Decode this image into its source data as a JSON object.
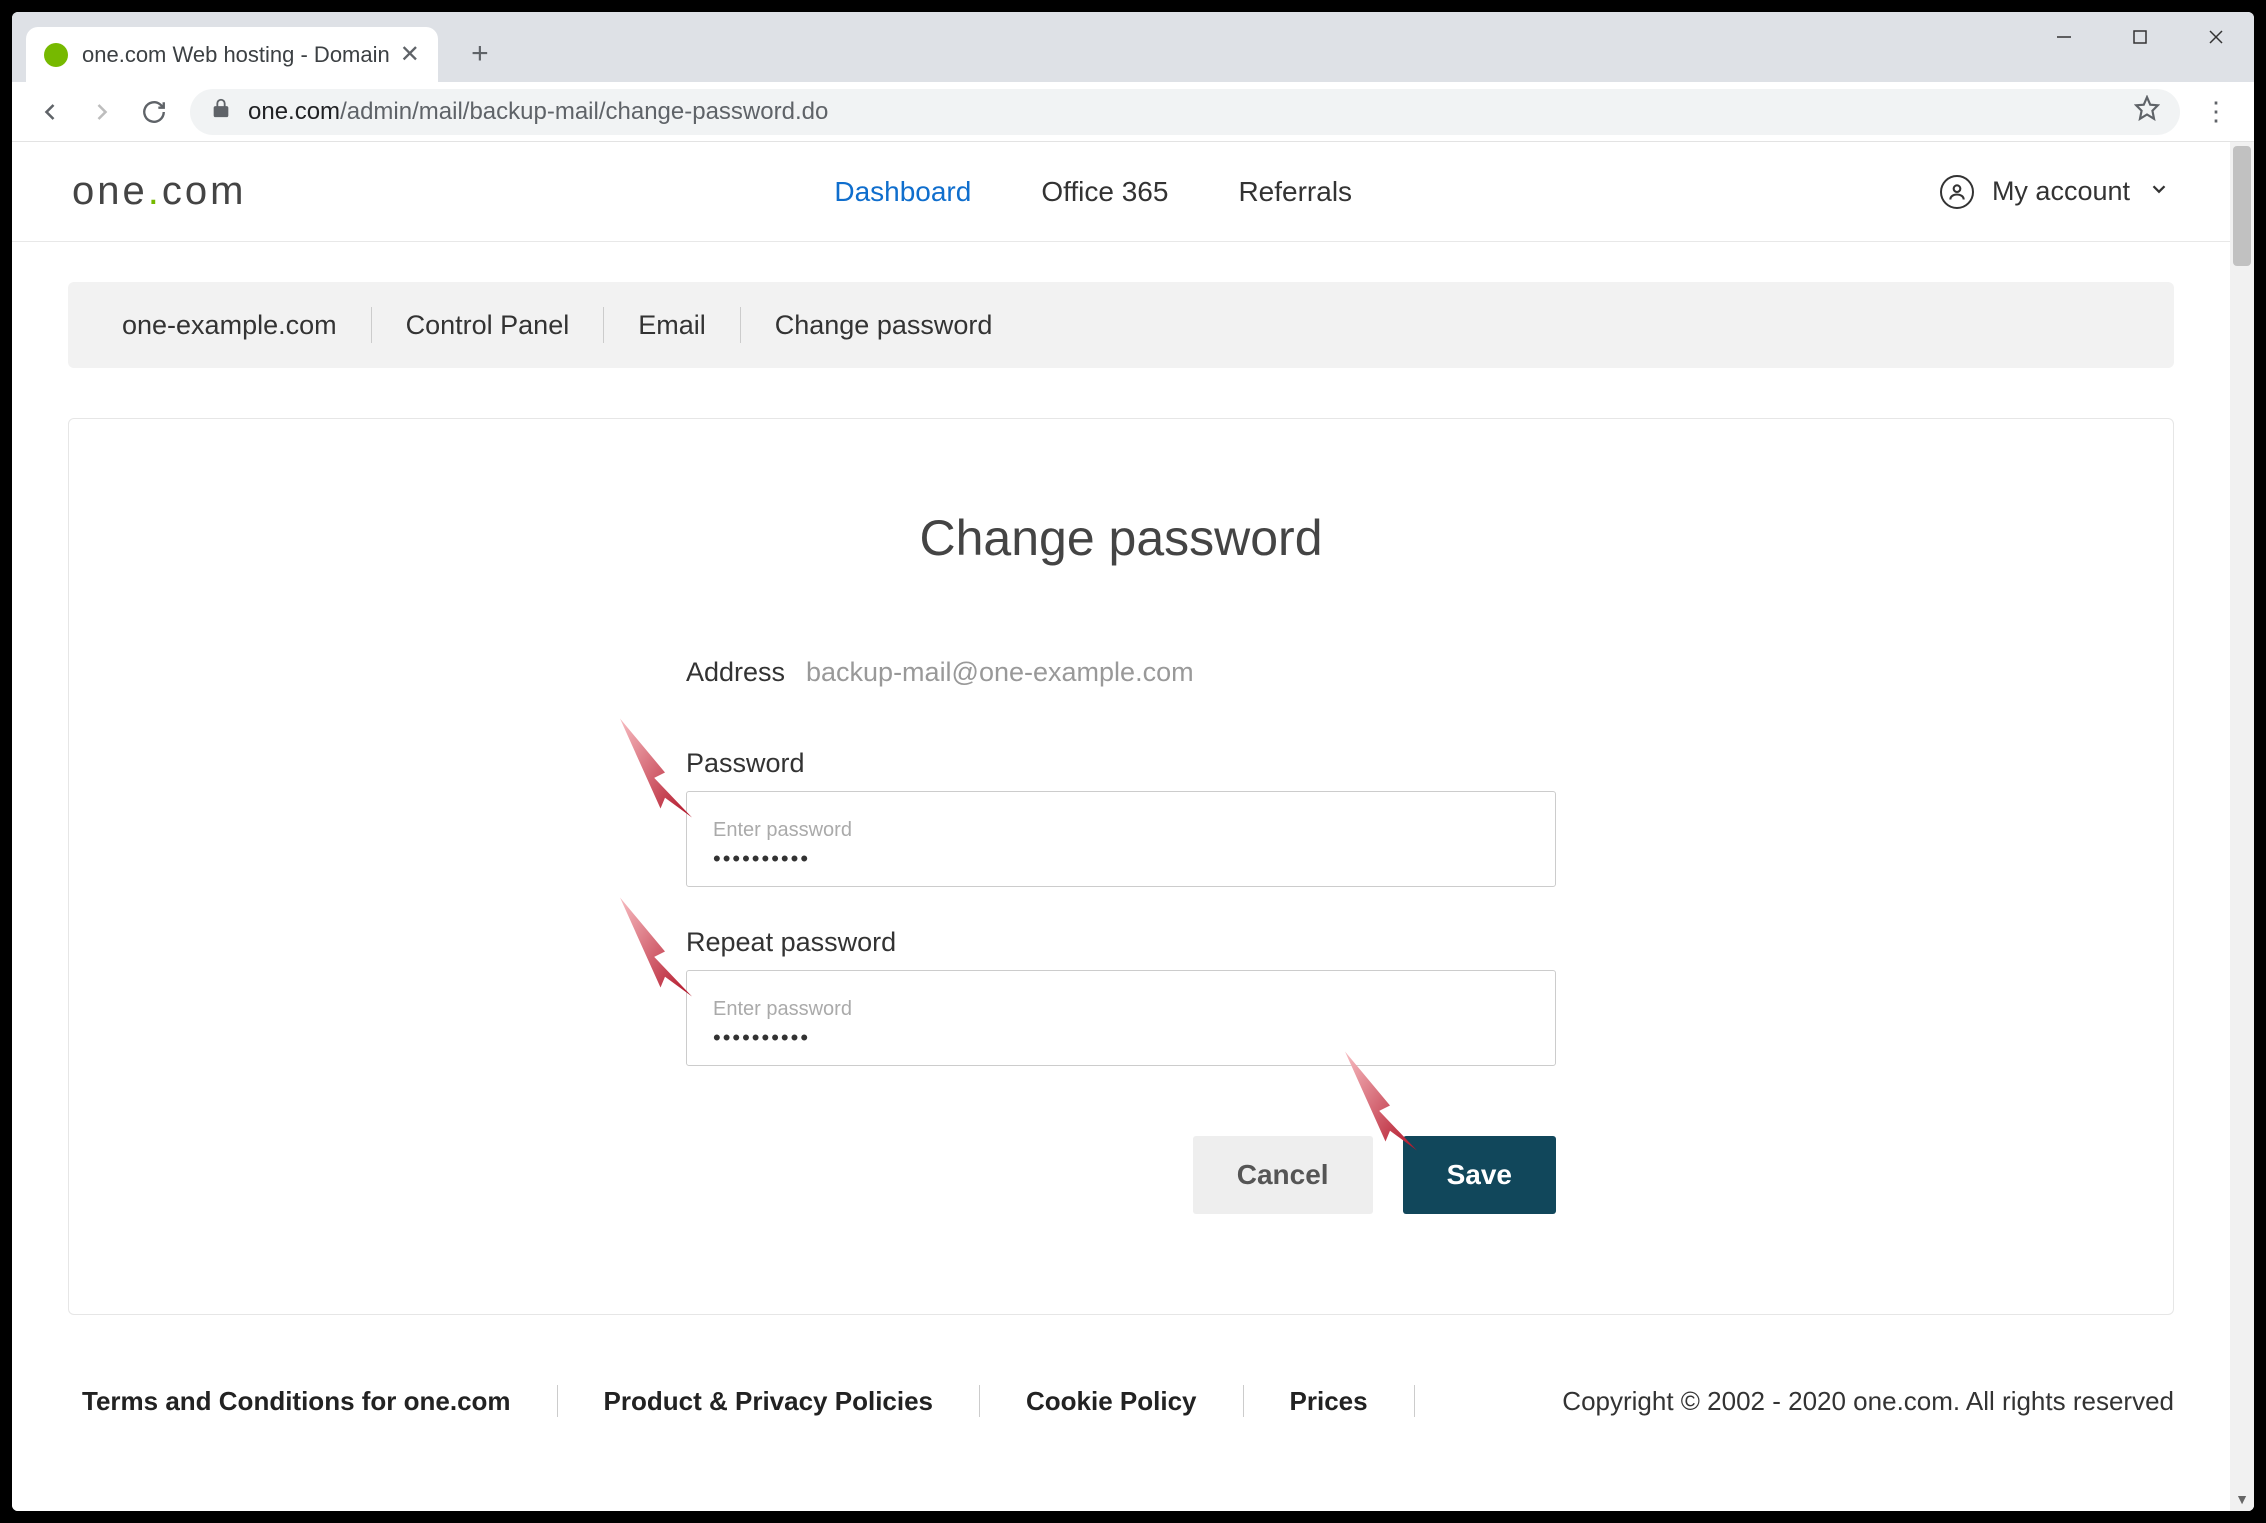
{
  "browser": {
    "tab_title": "one.com Web hosting  -  Domain",
    "url_host": "one.com",
    "url_path": "/admin/mail/backup-mail/change-password.do"
  },
  "header": {
    "logo_text_1": "one",
    "logo_dot": ".",
    "logo_text_2": "com",
    "nav": [
      {
        "label": "Dashboard",
        "active": true
      },
      {
        "label": "Office 365",
        "active": false
      },
      {
        "label": "Referrals",
        "active": false
      }
    ],
    "account_label": "My account"
  },
  "breadcrumb": [
    "one-example.com",
    "Control Panel",
    "Email",
    "Change password"
  ],
  "page": {
    "title": "Change password",
    "address_label": "Address",
    "address_value": "backup-mail@one-example.com",
    "password_label": "Password",
    "password_placeholder": "Enter password",
    "password_value": "••••••••••",
    "repeat_label": "Repeat password",
    "repeat_placeholder": "Enter password",
    "repeat_value": "••••••••••",
    "cancel_label": "Cancel",
    "save_label": "Save"
  },
  "footer": {
    "links": [
      "Terms and Conditions for one.com",
      "Product & Privacy Policies",
      "Cookie Policy",
      "Prices"
    ],
    "copyright": "Copyright © 2002 - 2020 one.com. All rights reserved"
  }
}
